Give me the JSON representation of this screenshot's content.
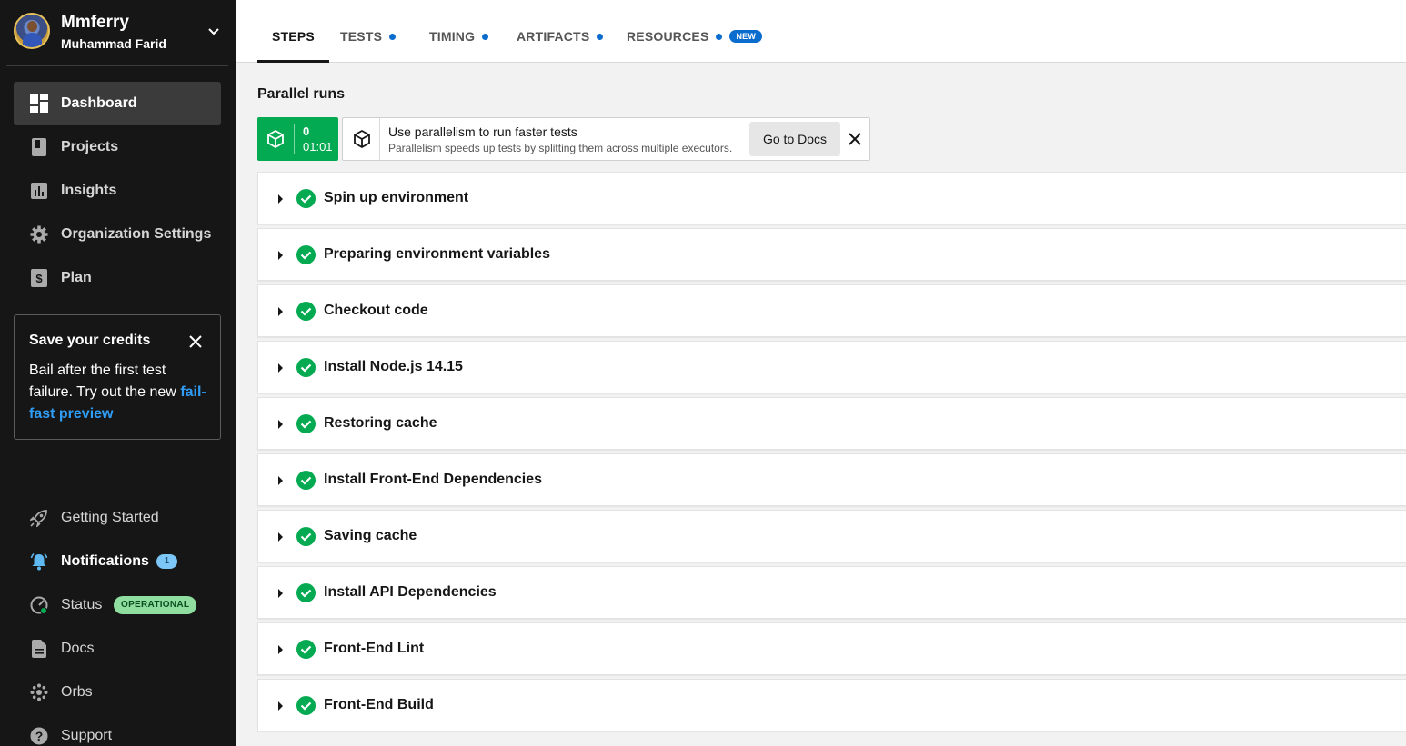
{
  "org": {
    "name": "Mmferry",
    "user": "Muhammad Farid"
  },
  "sidebar": {
    "items": [
      {
        "label": "Dashboard",
        "icon": "dashboard-icon",
        "active": true
      },
      {
        "label": "Projects",
        "icon": "projects-icon"
      },
      {
        "label": "Insights",
        "icon": "insights-icon"
      },
      {
        "label": "Organization Settings",
        "icon": "gear-icon"
      },
      {
        "label": "Plan",
        "icon": "dollar-icon"
      }
    ],
    "promo": {
      "title": "Save your credits",
      "text": "Bail after the first test failure. Try out the new ",
      "link": "fail-fast preview"
    },
    "bottom": [
      {
        "label": "Getting Started",
        "icon": "rocket-icon"
      },
      {
        "label": "Notifications",
        "icon": "bell-icon",
        "badge": "1"
      },
      {
        "label": "Status",
        "icon": "status-icon",
        "badge": "OPERATIONAL"
      },
      {
        "label": "Docs",
        "icon": "doc-icon"
      },
      {
        "label": "Orbs",
        "icon": "orbs-icon"
      },
      {
        "label": "Support",
        "icon": "help-icon"
      }
    ]
  },
  "tabs": [
    {
      "label": "STEPS",
      "active": true
    },
    {
      "label": "TESTS",
      "dot": true
    },
    {
      "label": "TIMING",
      "dot": true
    },
    {
      "label": "ARTIFACTS",
      "dot": true
    },
    {
      "label": "RESOURCES",
      "dot": true,
      "badge": "NEW"
    }
  ],
  "parallel": {
    "title": "Parallel runs",
    "run_index": "0",
    "run_time": "01:01",
    "tip_title": "Use parallelism to run faster tests",
    "tip_sub": "Parallelism speeds up tests by splitting them across multiple executors.",
    "docs_button": "Go to Docs"
  },
  "steps": [
    "Spin up environment",
    "Preparing environment variables",
    "Checkout code",
    "Install Node.js 14.15",
    "Restoring cache",
    "Install Front-End Dependencies",
    "Saving cache",
    "Install API Dependencies",
    "Front-End Lint",
    "Front-End Build"
  ],
  "colors": {
    "success": "#04aa51",
    "accent": "#0a6ccd",
    "sidebar": "#161616"
  }
}
